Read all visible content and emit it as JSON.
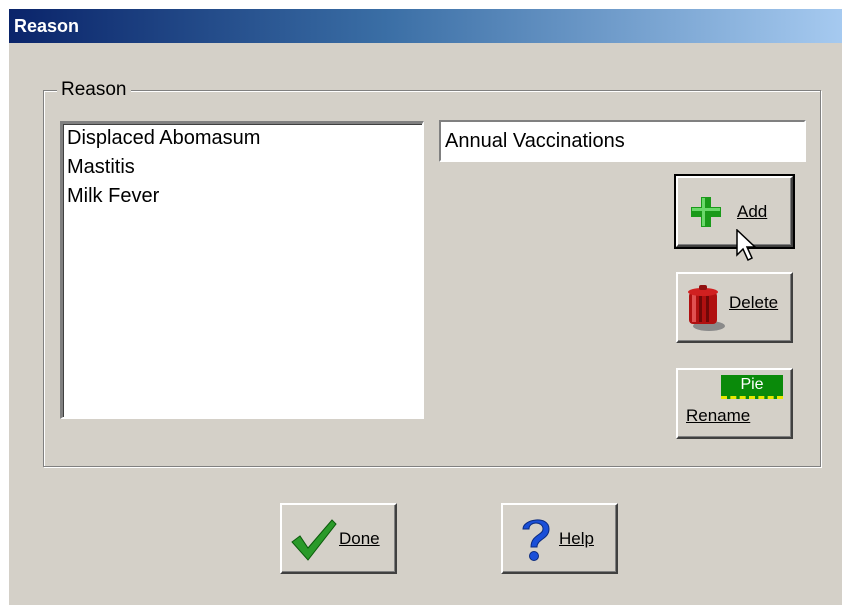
{
  "window": {
    "title": "Reason"
  },
  "group": {
    "label": "Reason"
  },
  "reason_list": {
    "items": [
      "Displaced Abomasum",
      "Mastitis",
      "Milk Fever"
    ]
  },
  "reason_input": {
    "value": "Annual Vaccinations"
  },
  "buttons": {
    "add": "Add",
    "delete": "Delete",
    "rename": "Rename",
    "rename_icon_text": "Pie",
    "done": "Done",
    "help": "Help"
  },
  "colors": {
    "title_start": "#0a246a",
    "title_end": "#a6caf0",
    "face": "#d4d0c8",
    "add_icon": "#1a9a1a",
    "delete_icon": "#b01010",
    "done_check": "#2a9a2a",
    "help_icon": "#1a4fd8",
    "rename_badge": "#0a8a0a"
  },
  "icons": {
    "add": "plus-icon",
    "delete": "trash-can-icon",
    "rename": "rename-label-icon",
    "done": "checkmark-icon",
    "help": "question-mark-icon",
    "cursor": "mouse-pointer-icon"
  }
}
